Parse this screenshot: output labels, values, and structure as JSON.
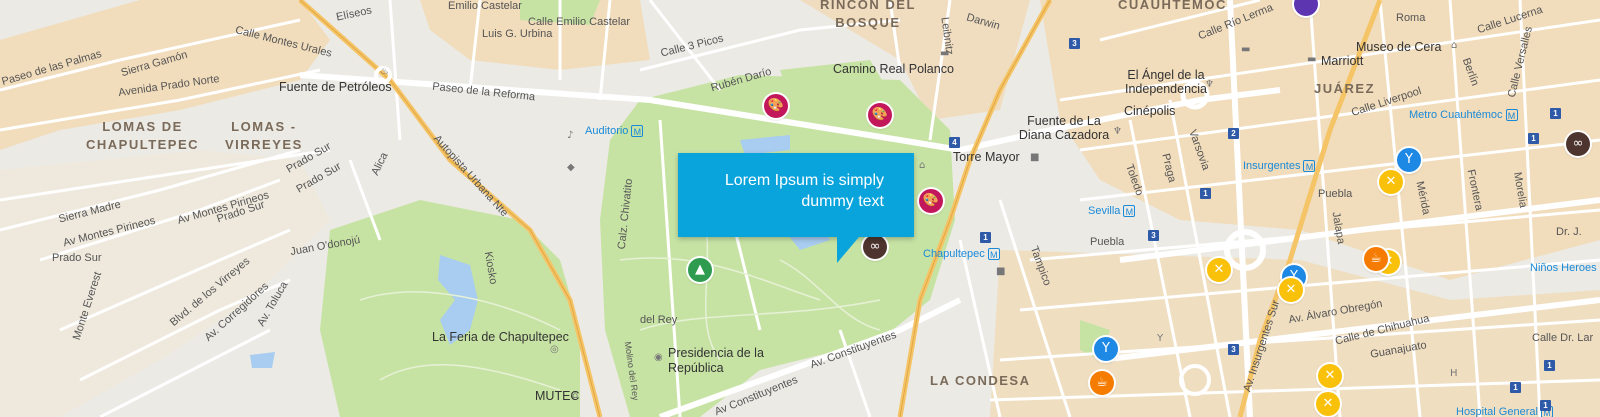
{
  "districts": [
    {
      "id": "rincon",
      "line1": "RINCÓN DEL",
      "line2": "BOSQUE"
    },
    {
      "id": "cuauhtemoc",
      "line1": "CUAUHTÉMOC",
      "line2": ""
    },
    {
      "id": "lomas",
      "line1": "LOMAS DE",
      "line2": "CHAPULTEPEC"
    },
    {
      "id": "virreyes",
      "line1": "LOMAS -",
      "line2": "VIRREYES"
    },
    {
      "id": "juarez",
      "line1": "JUÁREZ",
      "line2": ""
    },
    {
      "id": "condesa",
      "line1": "LA CONDESA",
      "line2": ""
    }
  ],
  "streets": {
    "elisos": "Elíseos",
    "castelar1": "Emilio Castelar",
    "castelar2": "Calle Emilio Castelar",
    "urbina": "Luis G. Urbina",
    "palmas": "Paseo de las Palmas",
    "gamon": "Sierra Gamón",
    "urales": "Calle Montes Urales",
    "prado_norte": "Avenida Prado Norte",
    "picos": "Calle 3 Picos",
    "rubendario": "Rubén Darío",
    "reforma": "Paseo de la Reforma",
    "autopista": "Autopista Urbana Nte",
    "alica": "Alica",
    "prado_sur1": "Prado Sur",
    "prado_sur2": "Prado Sur",
    "prado_sur3": "Prado Sur",
    "sierra_madre": "Sierra Madre",
    "pirineos1": "Av Montes Pirineos",
    "pirineos2": "Av Montes Pirineos",
    "odonoju": "Juan O'donojú",
    "everest": "Monte Everest",
    "virreyes_blvd": "Blvd. de los Virreyes",
    "corregidores": "Av. Corregidores",
    "toluca": "Av. Toluca",
    "kiosko": "Kiosko",
    "chivatito": "Calz. Chivatito",
    "delrey": "del Rey",
    "molino": "Molino del Rey",
    "constituyentes1": "Av Constituyentes",
    "constituyentes2": "Av. Constituyentes",
    "leibnitz": "Leibnitz",
    "darwin": "Darwin",
    "rio_lerma": "Calle Río Lerma",
    "roma": "Roma",
    "lucerna": "Calle Lucerna",
    "berlin": "Berlín",
    "versalles": "Calle Versalles",
    "liverpool": "Calle Liverpool",
    "varsovia": "Varsovia",
    "toledo": "Toledo",
    "praga": "Praga",
    "puebla1": "Puebla",
    "puebla2": "Puebla",
    "jalapa": "Jalapa",
    "merida": "Mérida",
    "frontera": "Frontera",
    "morelia": "Morelia",
    "tampico": "Tampico",
    "obregon": "Av. Álvaro Obregón",
    "chihuahua": "Calle de Chihuahua",
    "guanajuato": "Guanajuato",
    "insurgentes_sur": "Av. Insurgentes Sur",
    "calle_dr_j": "Dr. J.",
    "calle_dr_l": "Calle Dr. Lar"
  },
  "pois": {
    "petroleos": "Fuente de Petróleos",
    "camino_real": "Camino Real Polanco",
    "angel": "El Ángel de la Independencia",
    "cinepolis": "Cinépolis",
    "diana": "Fuente de La Diana Cazadora",
    "torre_mayor": "Torre Mayor",
    "museo_cera": "Museo de Cera",
    "marriott": "Marriott",
    "feria": "La Feria de Chapultepec",
    "presidencia": "Presidencia de la República",
    "mutec": "MUTEC"
  },
  "transit": {
    "auditorio": "Auditorio",
    "insurgentes": "Insurgentes",
    "sevilla": "Sevilla",
    "chapultepec": "Chapultepec",
    "metro_cuauhtemoc": "Metro Cuauhtémoc",
    "ninos_heroes": "Niños Heroes",
    "hospital_general": "Hospital General",
    "metro_symbol": "M"
  },
  "road_signs": [
    "3",
    "4",
    "1",
    "2",
    "1",
    "3",
    "1",
    "1",
    "3",
    "1",
    "1",
    "1"
  ],
  "map_pins": [
    {
      "icon": "palette-icon",
      "glyph": "🎨",
      "color": "#c2185b"
    },
    {
      "icon": "palette-icon",
      "glyph": "🎨",
      "color": "#c2185b"
    },
    {
      "icon": "palette-icon",
      "glyph": "🎨",
      "color": "#c2185b"
    },
    {
      "icon": "tree-icon",
      "glyph": "▲",
      "color": "#2e9b4e"
    },
    {
      "icon": "binoculars-icon",
      "glyph": "∞",
      "color": "#4e342e"
    },
    {
      "icon": "binoculars-icon",
      "glyph": "∞",
      "color": "#4e342e"
    },
    {
      "icon": "cocktail-icon",
      "glyph": "Y",
      "color": "#1e88e5"
    },
    {
      "icon": "cocktail-icon",
      "glyph": "Y",
      "color": "#1e88e5"
    },
    {
      "icon": "cocktail-icon",
      "glyph": "Y",
      "color": "#1e88e5"
    },
    {
      "icon": "restaurant-icon",
      "glyph": "✕",
      "color": "#f9c10a"
    },
    {
      "icon": "restaurant-icon",
      "glyph": "✕",
      "color": "#f9c10a"
    },
    {
      "icon": "restaurant-icon",
      "glyph": "✕",
      "color": "#f9c10a"
    },
    {
      "icon": "restaurant-icon",
      "glyph": "✕",
      "color": "#f9c10a"
    },
    {
      "icon": "restaurant-icon",
      "glyph": "✕",
      "color": "#f9c10a"
    },
    {
      "icon": "restaurant-icon",
      "glyph": "✕",
      "color": "#f9c10a"
    },
    {
      "icon": "coffee-icon",
      "glyph": "☕",
      "color": "#f57c00"
    },
    {
      "icon": "coffee-icon",
      "glyph": "☕",
      "color": "#f57c00"
    }
  ],
  "tooltip": {
    "line1": "Lorem Ipsum is simply",
    "line2": "dummy text"
  },
  "colors": {
    "park": "#c7e3a4",
    "urban": "#f1dcbb",
    "road": "#ffffff",
    "highway": "#f5c466",
    "water": "#a8cdf0",
    "tooltip": "#0aa4dc"
  }
}
